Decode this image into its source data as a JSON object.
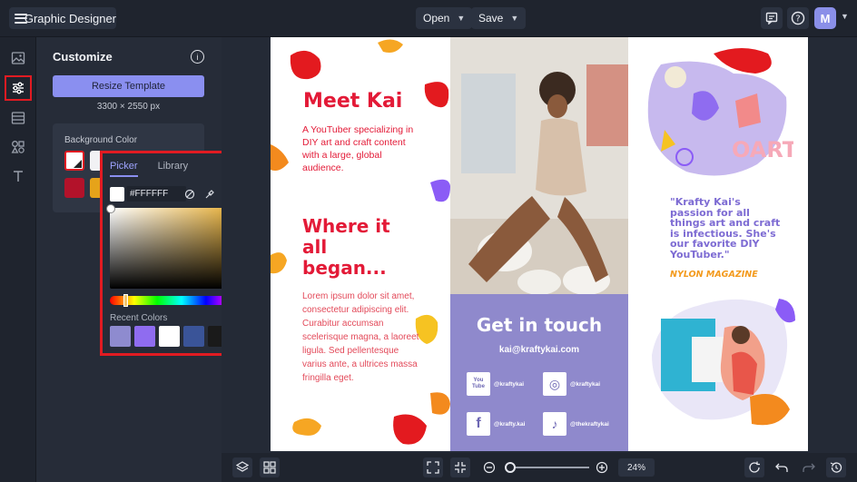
{
  "topbar": {
    "app_title": "Graphic Designer",
    "open_label": "Open",
    "save_label": "Save",
    "avatar_initial": "M"
  },
  "panel": {
    "title": "Customize",
    "resize_label": "Resize Template",
    "dimensions": "3300 × 2550 px",
    "bg_color_label": "Background Color",
    "bg_swatches": [
      "#ffffff",
      "#f1f1f4",
      "#b3122a",
      "#e6a31a"
    ]
  },
  "picker": {
    "tab_picker": "Picker",
    "tab_library": "Library",
    "hex_value": "#FFFFFF",
    "base_hue": "#e0a11a",
    "recent_label": "Recent Colors",
    "recent_colors": [
      "#8e8bcf",
      "#8f6cf0",
      "#ffffff",
      "#3a5498",
      "#1a1a1a",
      "#efe2fb"
    ]
  },
  "brochure": {
    "meet_title": "Meet Kai",
    "intro": "A YouTuber specializing in DIY art and craft content with a large, global audience.",
    "where_title": "Where it all began...",
    "lorem": "Lorem ipsum dolor sit amet, consectetur adipiscing elit. Curabitur accumsan scelerisque magna, a laoreet ligula. Sed pellentesque varius ante, a ultrices massa fringilla eget.",
    "touch_title": "Get in touch",
    "email": "kai@kraftykai.com",
    "socials": [
      {
        "icon": "youtube-icon",
        "glyph": "You Tube",
        "handle": "@kraftykai"
      },
      {
        "icon": "instagram-icon",
        "glyph": "◎",
        "handle": "@kraftykai"
      },
      {
        "icon": "facebook-icon",
        "glyph": "f",
        "handle": "@krafty.kai"
      },
      {
        "icon": "tiktok-icon",
        "glyph": "♪",
        "handle": "@thekraftykai"
      }
    ],
    "quote": "\"Krafty Kai's passion for all things art and craft is infectious. She's our favorite DIY YouTuber.\"",
    "magazine": "NYLON MAGAZINE"
  },
  "zoom": {
    "percent": "24%",
    "level": 0.24
  }
}
